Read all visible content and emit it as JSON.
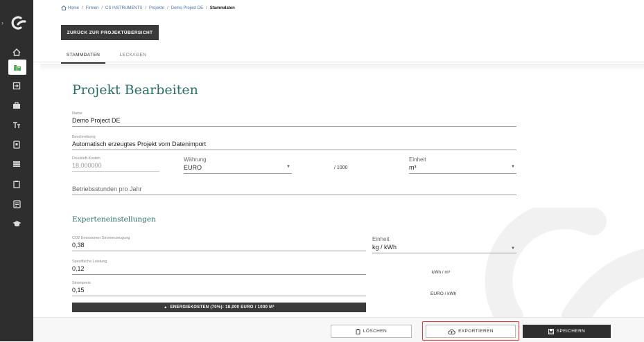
{
  "colors": {
    "sidebar": "#2e2e2e",
    "accent": "#2a6f68",
    "highlight": "#e53935",
    "link": "#4a6fa5"
  },
  "sidebar": {
    "icons": [
      "logo-icon",
      "home-icon",
      "building-icon",
      "import-icon",
      "briefcase-icon",
      "text-icon",
      "tablet-icon",
      "list-icon",
      "clipboard-icon",
      "document-icon",
      "graduation-icon"
    ]
  },
  "breadcrumb": {
    "items": [
      "Home",
      "Firmen",
      "CS INSTRUMENTS",
      "Projekte",
      "Demo Project DE"
    ],
    "current": "Stammdaten",
    "separator": "/"
  },
  "back_button": "ZURÜCK ZUR PROJEKTÜBERSICHT",
  "tabs": [
    {
      "label": "STAMMDATEN",
      "active": true
    },
    {
      "label": "LECKAGEN",
      "active": false
    }
  ],
  "form": {
    "title": "Projekt Bearbeiten",
    "name": {
      "label": "Name",
      "value": "Demo Project DE"
    },
    "description": {
      "label": "Beschreibung",
      "value": "Automatisch erzeugtes Projekt vom Datenimport"
    },
    "cost": {
      "label": "Druckluft-Kosten",
      "value": "18,000000"
    },
    "currency": {
      "label": "Währung",
      "value": "EURO"
    },
    "per": "/ 1000",
    "unit": {
      "label": "Einheit",
      "value": "m³"
    },
    "operating_hours": {
      "placeholder": "Betriebsstunden pro Jahr"
    }
  },
  "expert": {
    "title": "Experteneinstellungen",
    "co2": {
      "label": "CO2 Emissionen Stromerzeugung",
      "value": "0,38"
    },
    "co2_unit": {
      "label": "Einheit",
      "value": "kg / kWh"
    },
    "specific_power": {
      "label": "Spezifische Leistung",
      "value": "0,12",
      "unit": "kWh / m³"
    },
    "electricity_price": {
      "label": "Strompreis",
      "value": "0,15",
      "unit": "EURO / kWh"
    },
    "energy_costs": "ENERGIEKOSTEN (70%): 18,000 EURO / 1000 M³"
  },
  "footer": {
    "delete": "LÖSCHEN",
    "export": "EXPORTIEREN",
    "save": "SPEICHERN"
  }
}
